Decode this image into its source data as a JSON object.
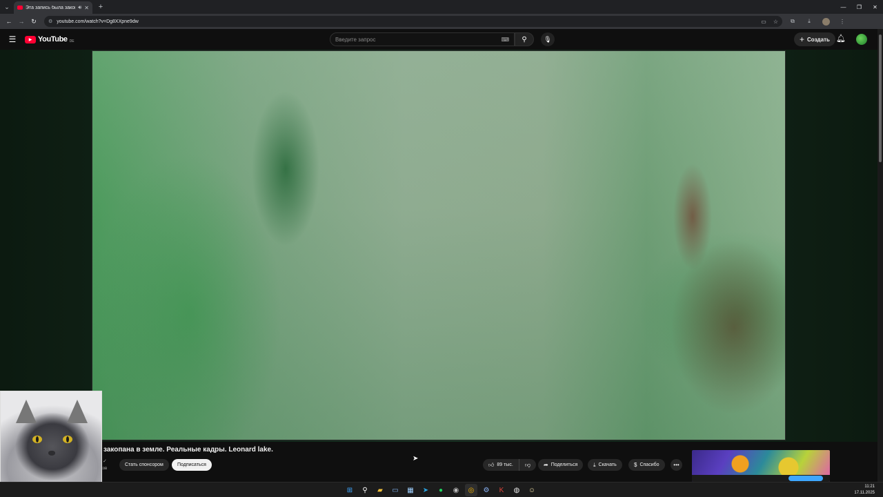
{
  "browser": {
    "tab_title": "Эта запись была закопана",
    "url": "youtube.com/watch?v=Dg8XXpne9dw"
  },
  "masthead": {
    "logo_text": "YouTube",
    "country_code": "DE",
    "search_placeholder": "Введите запрос",
    "create_label": "Создать"
  },
  "video": {
    "title": "закопана в земле. Реальные кадры. Leonard lake.",
    "channel_meta": "ков"
  },
  "actions": {
    "sponsor_label": "Стать спонсором",
    "subscribe_label": "Подписаться",
    "likes": "89 тыс.",
    "share_label": "Поделиться",
    "download_label": "Скачать",
    "thanks_label": "Спасибо"
  },
  "taskbar": {
    "time": "11:21",
    "date": "17.11.2025"
  },
  "colors": {
    "youtube_red": "#ff0033",
    "background": "#0f0f0f"
  }
}
